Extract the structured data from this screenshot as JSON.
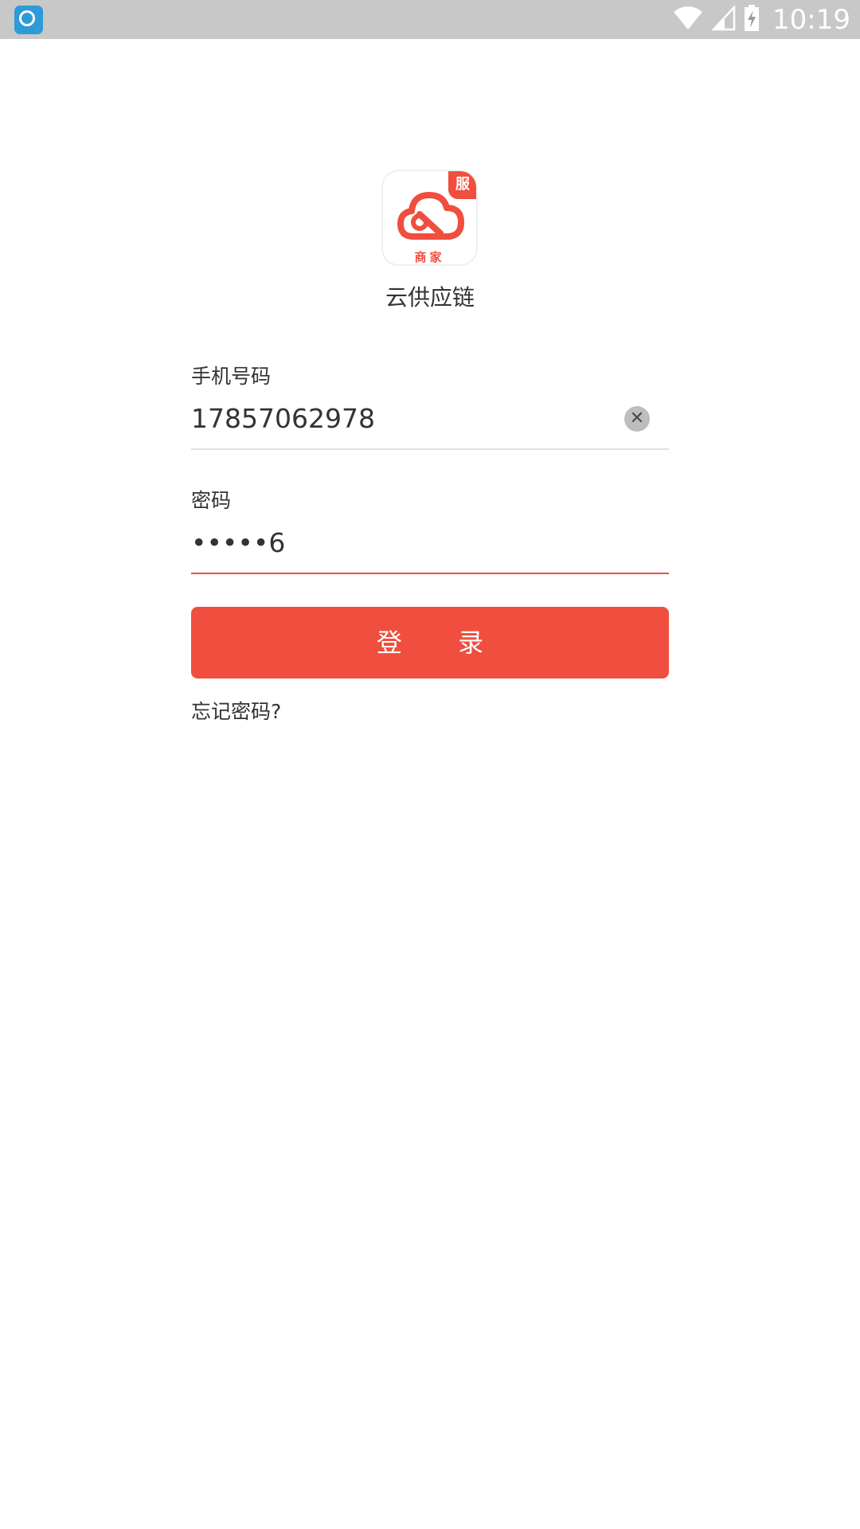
{
  "status_bar": {
    "time": "10:19",
    "app_icon": "nox-icon",
    "icons": [
      "wifi-icon",
      "signal-icon",
      "battery-charging-icon"
    ]
  },
  "app": {
    "name": "云供应链",
    "icon_sublabel": "商家",
    "icon_badge": "服",
    "brand_color": "#f04e3e"
  },
  "form": {
    "phone_label": "手机号码",
    "phone_value": "17857062978",
    "password_label": "密码",
    "password_value": "•••••6",
    "login_label": "登 录",
    "forgot_label": "忘记密码?"
  }
}
